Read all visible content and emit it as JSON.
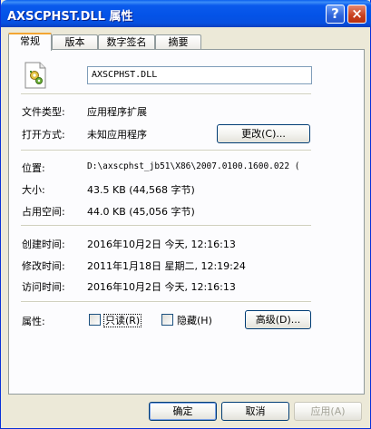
{
  "window": {
    "title": "AXSCPHST.DLL 属性",
    "help_glyph": "?",
    "close_glyph": "×"
  },
  "tabs": [
    {
      "label": "常规",
      "active": true
    },
    {
      "label": "版本",
      "active": false
    },
    {
      "label": "数字签名",
      "active": false
    },
    {
      "label": "摘要",
      "active": false
    }
  ],
  "general": {
    "file_name": "AXSCPHST.DLL",
    "file_type_label": "文件类型:",
    "file_type_value": "应用程序扩展",
    "opens_with_label": "打开方式:",
    "opens_with_value": "未知应用程序",
    "change_button": "更改(C)...",
    "location_label": "位置:",
    "location_value": "D:\\axscphst_jb51\\X86\\2007.0100.1600.022 (",
    "size_label": "大小:",
    "size_value": "43.5 KB (44,568 字节)",
    "size_on_disk_label": "占用空间:",
    "size_on_disk_value": "44.0 KB (45,056 字节)",
    "created_label": "创建时间:",
    "created_value": "2016年10月2日 今天, 12:16:13",
    "modified_label": "修改时间:",
    "modified_value": "2011年1月18日 星期二, 12:19:24",
    "accessed_label": "访问时间:",
    "accessed_value": "2016年10月2日 今天, 12:16:13",
    "attributes_label": "属性:",
    "readonly_label": "只读(R)",
    "hidden_label": "隐藏(H)",
    "advanced_button": "高级(D)..."
  },
  "footer": {
    "ok_button": "确定",
    "cancel_button": "取消",
    "apply_button": "应用(A)"
  },
  "colors": {
    "title_blue": "#0453E8",
    "dialog_face": "#ECE9D8",
    "tab_highlight": "#F3A532"
  }
}
